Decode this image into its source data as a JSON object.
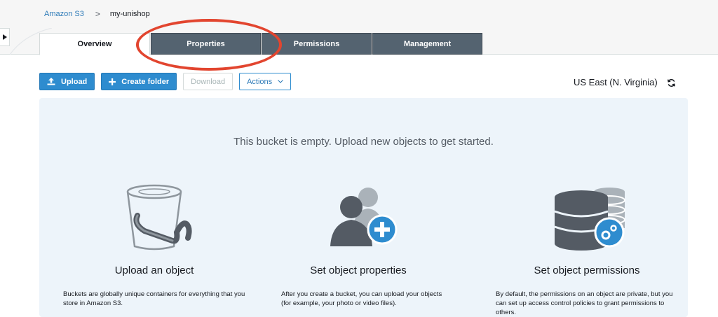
{
  "breadcrumb": {
    "root": "Amazon S3",
    "separator": ">",
    "current": "my-unishop"
  },
  "tabs": [
    {
      "label": "Overview",
      "active": true
    },
    {
      "label": "Properties",
      "active": false,
      "highlighted": true
    },
    {
      "label": "Permissions",
      "active": false
    },
    {
      "label": "Management",
      "active": false
    }
  ],
  "toolbar": {
    "upload_label": "Upload",
    "create_folder_label": "Create folder",
    "download_label": "Download",
    "actions_label": "Actions"
  },
  "region": "US East (N. Virginia)",
  "empty_state": {
    "message": "This bucket is empty. Upload new objects to get started.",
    "cards": [
      {
        "icon": "bucket-icon",
        "title": "Upload an object",
        "text": "Buckets are globally unique containers for everything that you store in Amazon S3."
      },
      {
        "icon": "users-add-icon",
        "title": "Set object properties",
        "text": "After you create a bucket, you can upload your objects (for example, your photo or video files)."
      },
      {
        "icon": "database-settings-icon",
        "title": "Set object permissions",
        "text": "By default, the permissions on an object are private, but you can set up access control policies to grant permissions to others."
      }
    ]
  },
  "colors": {
    "primary": "#2e8ccf",
    "tab_dark": "#546370",
    "panel_bg": "#edf4fa",
    "highlight": "#e2452f"
  }
}
